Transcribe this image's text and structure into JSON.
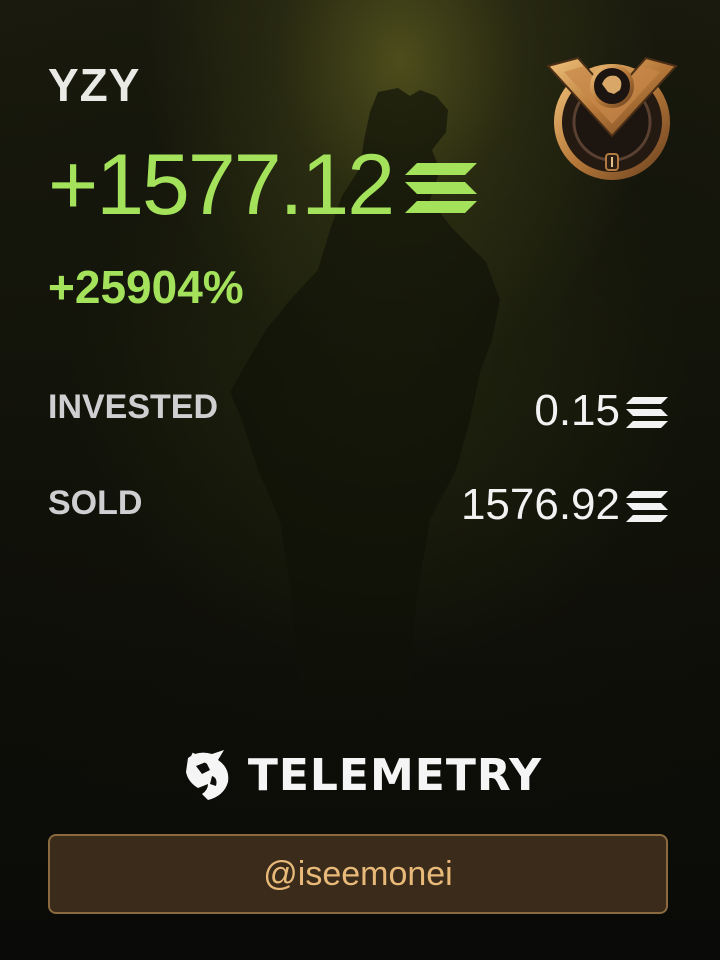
{
  "token": "YZY",
  "pnl": "+1577.12",
  "pnl_percent": "+25904%",
  "stats": {
    "invested_label": "INVESTED",
    "invested_value": "0.15",
    "sold_label": "SOLD",
    "sold_value": "1576.92"
  },
  "brand": {
    "name": "TELEMETRY",
    "icon": "telemetry-logo-icon"
  },
  "handle": "@iseemonei",
  "rank_badge": {
    "icon": "rank-badge-icon",
    "level": "I"
  },
  "currency_icon": "solana-icon",
  "colors": {
    "profit_green": "#a4e25c",
    "text_white": "#f2f2f2",
    "label_gray": "#cfcfd2",
    "handle_text": "#e8b978",
    "handle_border": "#8a6a3e",
    "handle_bg": "#3a2b1b"
  }
}
